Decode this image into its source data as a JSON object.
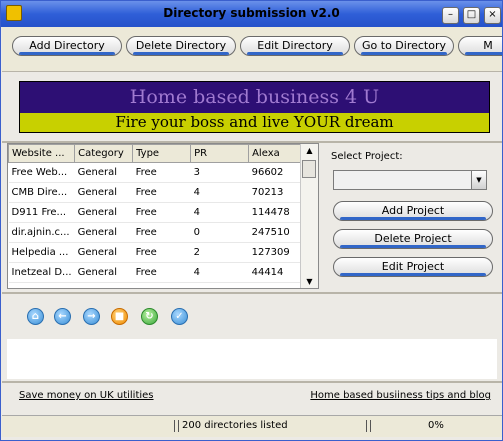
{
  "window": {
    "title": "Directory submission v2.0"
  },
  "toolbar": {
    "buttons": [
      {
        "label": "Add Directory"
      },
      {
        "label": "Delete Directory"
      },
      {
        "label": "Edit Directory"
      },
      {
        "label": "Go to Directory"
      },
      {
        "label": "M"
      }
    ]
  },
  "banner": {
    "headline": "Home based business 4 U",
    "tagline": "Fire your boss and live YOUR dream",
    "colors": {
      "top_bg": "#2d0f74",
      "top_text": "#a07ad0",
      "bottom_bg": "#c8d000"
    }
  },
  "directory_table": {
    "columns": [
      "Website ...",
      "Category",
      "Type",
      "PR",
      "Alexa"
    ],
    "rows": [
      [
        "Free Web...",
        "General",
        "Free",
        "3",
        "96602"
      ],
      [
        "CMB Dire...",
        "General",
        "Free",
        "4",
        "70213"
      ],
      [
        "D911 Fre...",
        "General",
        "Free",
        "4",
        "114478"
      ],
      [
        "dir.ajnin.c...",
        "General",
        "Free",
        "0",
        "247510"
      ],
      [
        "Helpedia ...",
        "General",
        "Free",
        "2",
        "127309"
      ],
      [
        "Inetzeal D...",
        "General",
        "Free",
        "4",
        "44414"
      ]
    ]
  },
  "project": {
    "label": "Select Project:",
    "selected": "",
    "add_label": "Add Project",
    "delete_label": "Delete Project",
    "edit_label": "Edit Project"
  },
  "nav_icons": [
    "home-icon",
    "back-icon",
    "forward-icon",
    "stop-icon",
    "refresh-icon",
    "check-icon"
  ],
  "links": {
    "left": "Save money on UK utilities",
    "right": "Home based busiiness tips and blog"
  },
  "status": {
    "count_text": "200 directories listed",
    "progress_text": "0%",
    "progress": 0
  }
}
